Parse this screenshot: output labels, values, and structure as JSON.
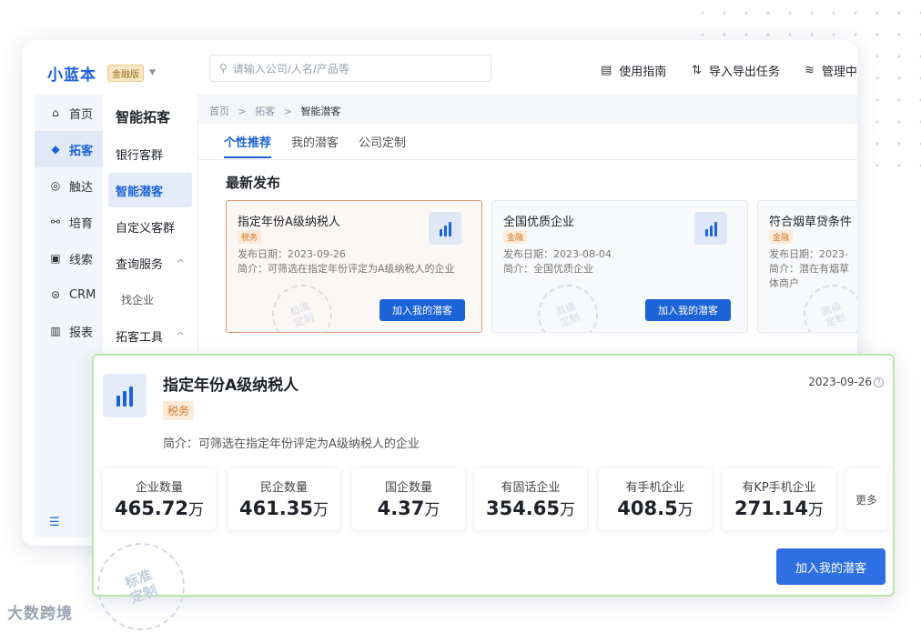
{
  "app": {
    "logo": "小蓝本",
    "edition_badge": "金融版"
  },
  "search": {
    "placeholder": "请输入公司/人名/产品等"
  },
  "toolbar": {
    "guide": "使用指南",
    "import_export": "导入导出任务",
    "manage": "管理中"
  },
  "leftnav": [
    {
      "label": "首页",
      "icon": "home-icon",
      "glyph": "⌂",
      "active": false
    },
    {
      "label": "拓客",
      "icon": "cube-icon",
      "glyph": "◆",
      "active": true
    },
    {
      "label": "触达",
      "icon": "target-icon",
      "glyph": "◎",
      "active": false
    },
    {
      "label": "培育",
      "icon": "nodes-icon",
      "glyph": "⚯",
      "active": false
    },
    {
      "label": "线索",
      "icon": "clue-icon",
      "glyph": "▣",
      "active": false
    },
    {
      "label": "CRM",
      "icon": "crm-icon",
      "glyph": "⊜",
      "active": false
    },
    {
      "label": "报表",
      "icon": "report-icon",
      "glyph": "▥",
      "active": false
    }
  ],
  "subnav": {
    "title": "智能拓客",
    "items": [
      {
        "label": "银行客群",
        "active": false,
        "expand": ""
      },
      {
        "label": "智能潜客",
        "active": true,
        "expand": ""
      },
      {
        "label": "自定义客群",
        "active": false,
        "expand": ""
      },
      {
        "label": "查询服务",
        "active": false,
        "expand": "^"
      },
      {
        "label": "找企业",
        "active": false,
        "small": true,
        "expand": ""
      },
      {
        "label": "拓客工具",
        "active": false,
        "expand": "^"
      }
    ]
  },
  "breadcrumb": {
    "home": "首页",
    "level1": "拓客",
    "current": "智能潜客",
    "sep": ">"
  },
  "tabs": [
    "个性推荐",
    "我的潜客",
    "公司定制"
  ],
  "section_title": "最新发布",
  "cards": [
    {
      "title": "指定年份A级纳税人",
      "tag": "税务",
      "date": "发布日期：2023-09-26",
      "desc": "简介：可筛选在指定年份评定为A级纳税人的企业",
      "desc2": "",
      "button": "加入我的潜客",
      "stamp": "标准\n定制"
    },
    {
      "title": "全国优质企业",
      "tag": "金融",
      "date": "发布日期：2023-08-04",
      "desc": "简介：全国优质企业",
      "desc2": "",
      "button": "加入我的潜客",
      "stamp": "高级\n定制"
    },
    {
      "title": "符合烟草贷条件",
      "tag": "金融",
      "date": "发布日期：2023-",
      "desc": "简介：潜在有烟草",
      "desc2": "体商户",
      "button": "",
      "stamp": "高级\n定制"
    }
  ],
  "popup": {
    "title": "指定年份A级纳税人",
    "tag": "税务",
    "date": "2023-09-26",
    "help": "?",
    "desc": "简介：可筛选在指定年份评定为A级纳税人的企业",
    "stats": [
      {
        "label": "企业数量",
        "value": "465.72",
        "unit": "万"
      },
      {
        "label": "民企数量",
        "value": "461.35",
        "unit": "万"
      },
      {
        "label": "国企数量",
        "value": "4.37",
        "unit": "万"
      },
      {
        "label": "有固话企业",
        "value": "354.65",
        "unit": "万"
      },
      {
        "label": "有手机企业",
        "value": "408.5",
        "unit": "万"
      },
      {
        "label": "有KP手机企业",
        "value": "271.14",
        "unit": "万"
      }
    ],
    "more": "更多",
    "button": "加入我的潜客",
    "stamp": "标准\n定制"
  },
  "watermark": "大数跨境",
  "colors": {
    "primary": "#1c63d8",
    "tag_orange": "#d2782a",
    "popup_border": "#b8e8a6"
  }
}
